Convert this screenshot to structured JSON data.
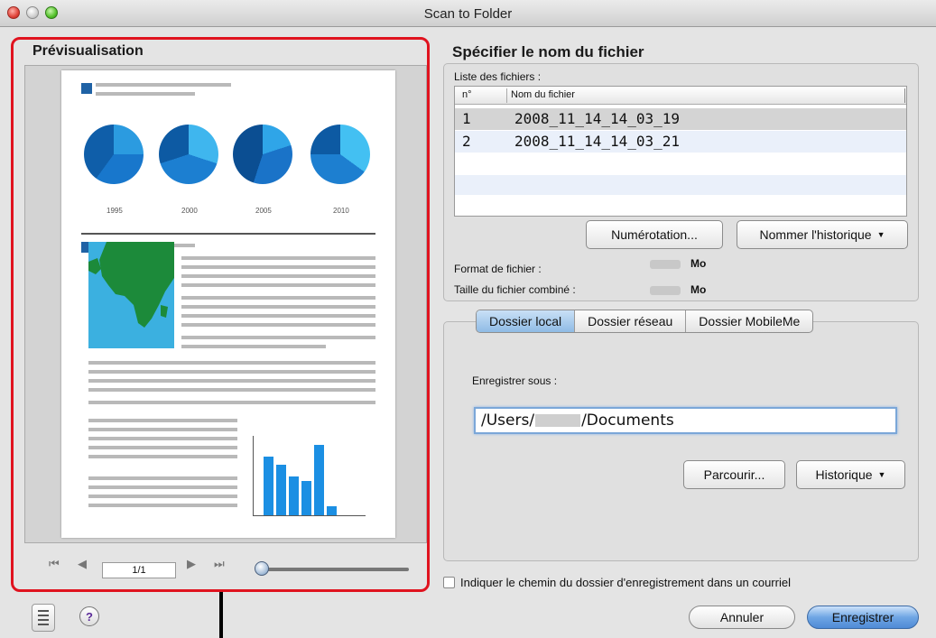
{
  "window": {
    "title": "Scan to Folder"
  },
  "preview": {
    "heading": "Prévisualisation",
    "years": [
      "1995",
      "2000",
      "2005",
      "2010"
    ],
    "page_indicator": "1/1"
  },
  "file_section": {
    "heading": "Spécifier le nom du fichier",
    "list_label": "Liste des fichiers :",
    "columns": [
      "n°",
      "Nom du fichier"
    ],
    "rows": [
      {
        "n": "1",
        "name": "2008_11_14_14_03_19"
      },
      {
        "n": "2",
        "name": "2008_11_14_14_03_21"
      }
    ],
    "numbering_button": "Numérotation...",
    "name_history_button": "Nommer l'historique",
    "format_label": "Format de fichier :",
    "combined_size_label": "Taille du fichier combiné :",
    "unit": "Mo"
  },
  "destination": {
    "tabs": [
      "Dossier local",
      "Dossier réseau",
      "Dossier MobileMe"
    ],
    "save_as_label": "Enregistrer sous :",
    "path_prefix": "/Users/",
    "path_suffix": "/Documents",
    "browse_button": "Parcourir...",
    "history_button": "Historique"
  },
  "email_checkbox_label": "Indiquer le chemin du dossier d'enregistrement dans un courriel",
  "buttons": {
    "cancel": "Annuler",
    "save": "Enregistrer"
  },
  "colors": {
    "highlight_red": "#e0131f",
    "accent_blue": "#4f8ad6"
  }
}
